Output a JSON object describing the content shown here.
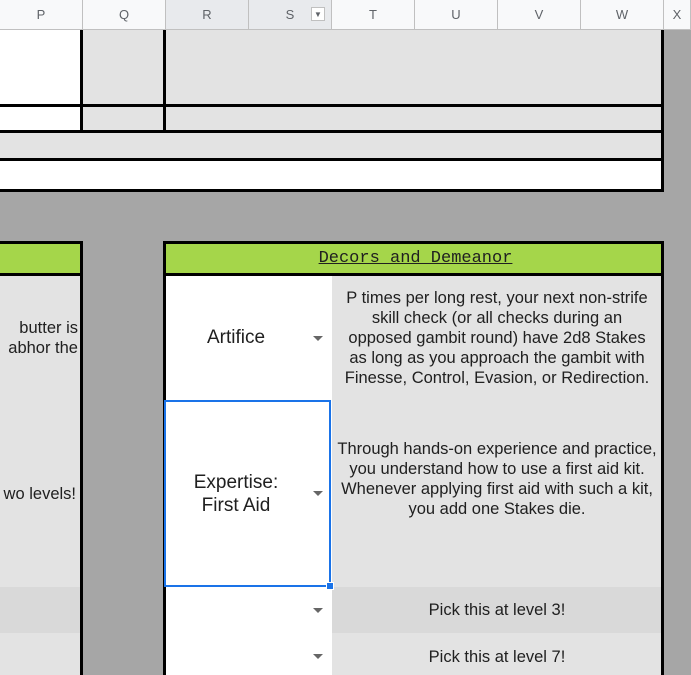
{
  "columns": [
    {
      "letter": "P"
    },
    {
      "letter": "Q"
    },
    {
      "letter": "R"
    },
    {
      "letter": "S"
    },
    {
      "letter": "T"
    },
    {
      "letter": "U"
    },
    {
      "letter": "V"
    },
    {
      "letter": "W"
    },
    {
      "letter": "X"
    }
  ],
  "left_panel": {
    "row1_text": "butter is\nabhor the",
    "row2_text": "wo levels!"
  },
  "right_panel": {
    "header": "Decors and Demeanor",
    "rows": [
      {
        "name": "Artifice",
        "description": "P times per long rest, your next non-strife skill check (or all checks during an opposed gambit round) have 2d8 Stakes as long as you approach the gambit with Finesse, Control, Evasion, or Redirection."
      },
      {
        "name": "Expertise:\nFirst Aid",
        "description": "Through hands-on experience and practice, you understand how to use a first aid kit. Whenever applying first aid with such a kit, you add one Stakes die."
      },
      {
        "name": "",
        "description": "Pick this at level 3!"
      },
      {
        "name": "",
        "description": "Pick this at level 7!"
      }
    ]
  },
  "colors": {
    "header_green": "#a5d64a",
    "cell_gray": "#e3e3e3",
    "background_gray": "#a6a6a6",
    "selection_blue": "#1a73e8"
  }
}
